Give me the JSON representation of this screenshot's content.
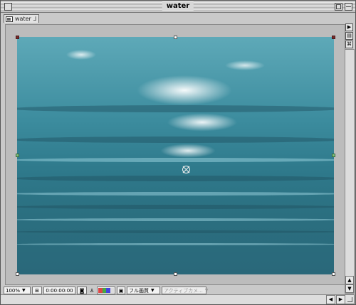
{
  "window": {
    "title": "water"
  },
  "tab": {
    "label": "water"
  },
  "toolbar": {
    "zoom": "100%",
    "timecode": "0:00:00:00",
    "resolution": "フル画質",
    "view": "アクティブカメ..."
  },
  "colors": {
    "water_top": "#5ea9b8",
    "water_bottom": "#2a687a",
    "corner_handle": "#7a2a2a"
  }
}
